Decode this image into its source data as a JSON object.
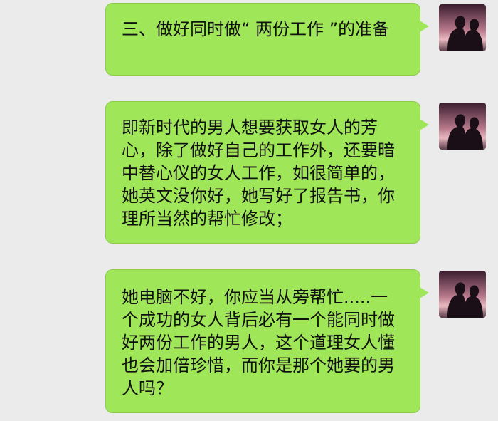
{
  "chat": {
    "messages": [
      {
        "sender": "self",
        "avatar_icon": "couple-silhouette-avatar",
        "text": "三、做好同时做“ 两份工作 ”的准备"
      },
      {
        "sender": "self",
        "avatar_icon": "couple-silhouette-avatar",
        "text": "即新时代的男人想要获取女人的芳心，除了做好自己的工作外，还要暗中替心仪的女人工作，如很简单的，她英文没你好，她写好了报告书，你理所当然的帮忙修改；"
      },
      {
        "sender": "self",
        "avatar_icon": "couple-silhouette-avatar",
        "text": "她电脑不好，你应当从旁帮忙.....一个成功的女人背后必有一个能同时做好两份工作的男人，这个道理女人懂也会加倍珍惜，而你是那个她要的男人吗？"
      }
    ],
    "colors": {
      "background": "#ebebeb",
      "bubble": "#9fe658",
      "bubble_border": "#8ccd4c"
    }
  }
}
